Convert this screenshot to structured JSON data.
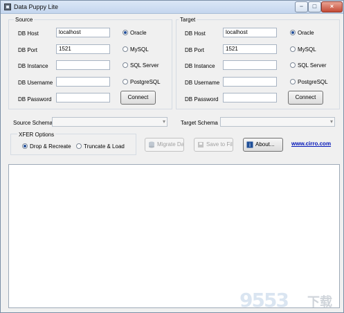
{
  "window": {
    "title": "Data Puppy Lite"
  },
  "source": {
    "section_label": "Source",
    "fields": [
      {
        "label": "DB Host",
        "value": "localhost"
      },
      {
        "label": "DB Port",
        "value": "1521"
      },
      {
        "label": "DB Instance",
        "value": ""
      },
      {
        "label": "DB Username",
        "value": ""
      },
      {
        "label": "DB Password",
        "value": ""
      }
    ],
    "db_types": [
      "Oracle",
      "MySQL",
      "SQL Server",
      "PostgreSQL"
    ],
    "selected_db": "Oracle",
    "connect_label": "Connect"
  },
  "target": {
    "section_label": "Target",
    "fields": [
      {
        "label": "DB Host",
        "value": "localhost"
      },
      {
        "label": "DB Port",
        "value": "1521"
      },
      {
        "label": "DB Instance",
        "value": ""
      },
      {
        "label": "DB Username",
        "value": ""
      },
      {
        "label": "DB Password",
        "value": ""
      }
    ],
    "db_types": [
      "Oracle",
      "MySQL",
      "SQL Server",
      "PostgreSQL"
    ],
    "selected_db": "Oracle",
    "connect_label": "Connect"
  },
  "schema": {
    "source_label": "Source Schema",
    "target_label": "Target Schema",
    "source_value": "",
    "target_value": ""
  },
  "xfer": {
    "label": "XFER Options",
    "options": [
      "Drop & Recreate",
      "Truncate & Load"
    ],
    "selected": "Drop & Recreate"
  },
  "actions": {
    "migrate": "Migrate Data",
    "save": "Save to File",
    "about": "About..."
  },
  "link": {
    "text": "www.cirro.com"
  },
  "watermark": {
    "text": "9553",
    "mark": "下载"
  },
  "icons": {
    "app": "app-icon",
    "migrate": "database-icon",
    "save": "save-icon",
    "about": "info-icon"
  },
  "colors": {
    "accent": "#234f9a",
    "link": "#0014b8"
  }
}
